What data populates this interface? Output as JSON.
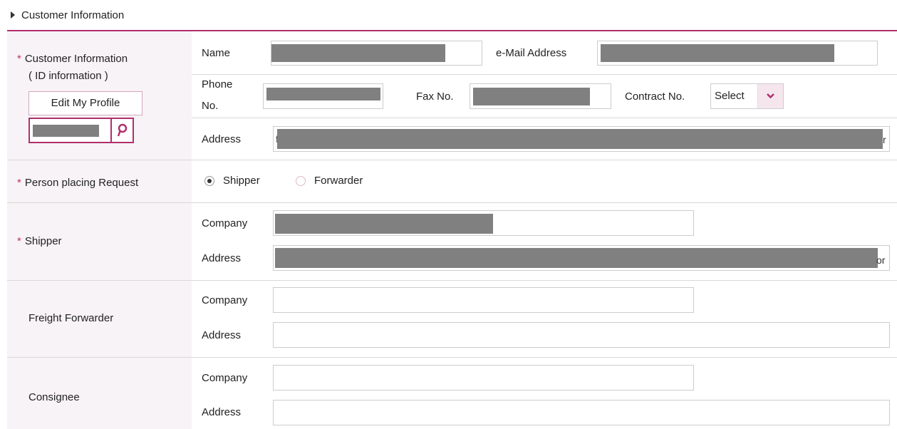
{
  "section": {
    "title": "Customer Information"
  },
  "customer_info": {
    "label_line1": "Customer Information",
    "label_line2": "( ID information )",
    "edit_profile_label": "Edit My Profile",
    "name_label": "Name",
    "email_label": "e-Mail Address",
    "phone_label_line1": "Phone",
    "phone_label_line2": "No.",
    "fax_label": "Fax No.",
    "contract_label": "Contract No.",
    "contract_select_value": "Select",
    "address_label": "Address",
    "address_lead": "f",
    "address_tail": "r"
  },
  "request": {
    "label": "Person placing Request",
    "options": [
      "Shipper",
      "Forwarder"
    ],
    "selected": "Shipper"
  },
  "shipper": {
    "label": "Shipper",
    "company_label": "Company",
    "address_label": "Address",
    "address_tail": "or"
  },
  "forwarder": {
    "label": "Freight Forwarder",
    "company_label": "Company",
    "address_label": "Address"
  },
  "consignee": {
    "label": "Consignee",
    "company_label": "Company",
    "address_label": "Address"
  },
  "required_marker": "*",
  "colors": {
    "accent": "#b0306e",
    "label_bg": "#f8f3f6",
    "redaction": "#808080"
  },
  "icons": {
    "section_toggle": "triangle-right-icon",
    "search": "search-icon",
    "dropdown": "chevron-down-icon"
  }
}
